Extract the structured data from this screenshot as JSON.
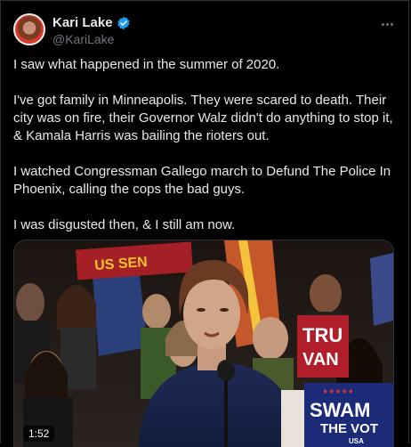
{
  "author": {
    "name": "Kari Lake",
    "handle": "@KariLake",
    "verified_color": "#1d9bf0"
  },
  "tweet": {
    "paragraphs": [
      "I saw what happened in the summer of 2020.",
      "I've got family in Minneapolis. They were scared to death. Their city was on fire, their Governor Walz didn't do anything to stop it, & Kamala Harris was bailing the rioters out.",
      "I watched Congressman Gallego march to Defund The Police In Phoenix, calling the cops the bad guys.",
      "I was disgusted then, & I still am now."
    ]
  },
  "video": {
    "duration": "1:52",
    "sign_left": "US SEN",
    "sign_truth": "TRU",
    "sign_truth_2": "VAN",
    "sign_swamp": "SWAM",
    "sign_swamp_2": "THE VOT",
    "sign_swamp_3": "USA"
  }
}
